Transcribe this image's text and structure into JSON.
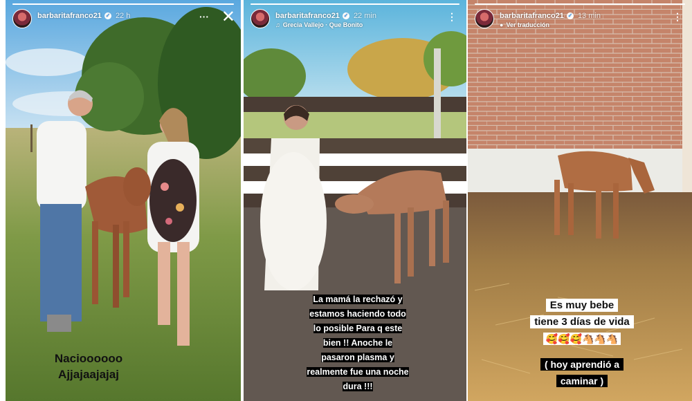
{
  "stories": [
    {
      "username": "barbaritafranco21",
      "time": "22 h",
      "caption": [
        "Nacioooooo",
        "Ajjajaajajaj"
      ]
    },
    {
      "username": "barbaritafranco21",
      "time": "22 min",
      "music": "Grecia Vallejo · Que Bonito",
      "caption": [
        "La mamá la rechazó y",
        "estamos haciendo todo",
        "lo posible Para q este",
        "bien !!  Anoche le",
        "pasaron plasma y",
        "realmente fue una noche",
        "dura !!!"
      ]
    },
    {
      "username": "barbaritafranco21",
      "time": "13 min",
      "translate": "Ver traducción",
      "caption_top": [
        "Es muy bebe",
        "tiene 3 días de vida"
      ],
      "emojis": "🥰🥰🥰🐴🐴🐴",
      "caption_bottom": [
        "( hoy aprendió a",
        "caminar )"
      ]
    }
  ],
  "colors": {
    "accent_verified": "#3897f0"
  },
  "icons": [
    "verified-icon",
    "more-icon",
    "close-icon",
    "music-note-icon",
    "translate-icon"
  ]
}
